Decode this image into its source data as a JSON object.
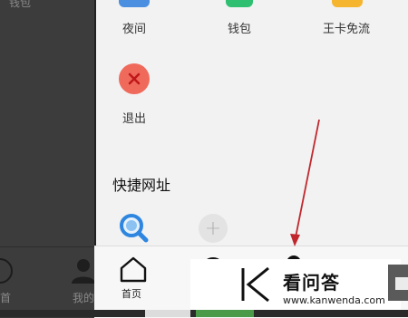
{
  "background_app": {
    "top_label": "钱包",
    "nav_left_label": "首",
    "nav_mine_label": "我的"
  },
  "drawer": {
    "row1": [
      {
        "label": "夜间",
        "icon": "moon-icon",
        "color": "#4a8fe0"
      },
      {
        "label": "钱包",
        "icon": "wallet-icon",
        "color": "#2fbf71"
      },
      {
        "label": "王卡免流",
        "icon": "card-icon",
        "color": "#f5b52e"
      }
    ],
    "row2": [
      {
        "label": "退出",
        "icon": "exit-icon",
        "color": "#f06a5c"
      }
    ],
    "shortcuts_title": "快捷网址"
  },
  "bottom_nav": {
    "home_label": "首页"
  },
  "watermark": {
    "title": "看问答",
    "url": "www.kanwenda.com"
  },
  "annotation": {
    "arrow_color": "#c0272d"
  }
}
